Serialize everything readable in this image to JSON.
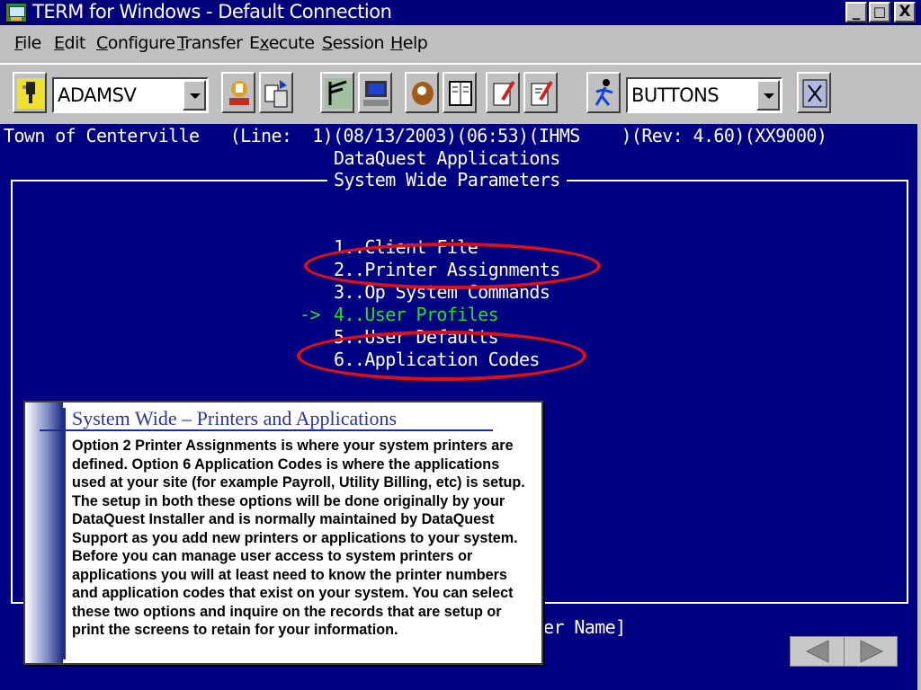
{
  "window": {
    "title": "TERM for Windows - Default Connection",
    "buttons": [
      "_",
      "□",
      "X"
    ]
  },
  "menu": [
    "File",
    "Edit",
    "Configure",
    "Transfer",
    "Execute",
    "Session",
    "Help"
  ],
  "menu_mnemonics": [
    "F",
    "E",
    "C",
    "T",
    "x",
    "S",
    "H"
  ],
  "toolbar": {
    "user_combo": "ADAMSV",
    "buttons_combo": "BUTTONS",
    "icons": [
      "connect-plug-icon",
      "hangup-phone-icon",
      "transfer-files-icon",
      "antenna-icon",
      "computer-icon",
      "baseball-glove-icon",
      "book-icon",
      "edit-pencil-icon",
      "write-pencil-icon",
      "runner-icon",
      "buttons-edit-icon"
    ]
  },
  "terminal": {
    "status_line": "Town of Centerville   (Line:  1)(08/13/2003)(06:53)(IHMS    )(Rev: 4.60)(XX9000)",
    "app_title": "DataQuest Applications",
    "screen_title": "System Wide Parameters",
    "menu_items": [
      "1..Client File",
      "2..Printer Assignments",
      "3..Op System Commands",
      "4..User Profiles",
      "5..User Defaults",
      "6..Application Codes"
    ],
    "selected_marker": "->",
    "partial_prompt": "er Name]"
  },
  "callout": {
    "title": "System Wide – Printers and Applications",
    "body": "Option 2 Printer Assignments is where your system printers are defined.  Option 6 Application Codes is where the applications used at your site (for example Payroll, Utility Billing, etc) is setup.  The setup in both these options will be done originally by your DataQuest Installer and is normally maintained by DataQuest Support as you add new printers or applications to your system.  Before you can manage user access to system printers or applications you will at least need to know the printer numbers and application codes that exist on your system.  You can select these two options and inquire on the records that are setup or print the screens to retain for your information."
  },
  "colors": {
    "terminal_bg": "#000082",
    "highlight_green": "#20e020",
    "annotation_red": "#e01010",
    "callout_title": "#2a35a8"
  },
  "nav": [
    "back-arrow-icon",
    "forward-arrow-icon"
  ]
}
